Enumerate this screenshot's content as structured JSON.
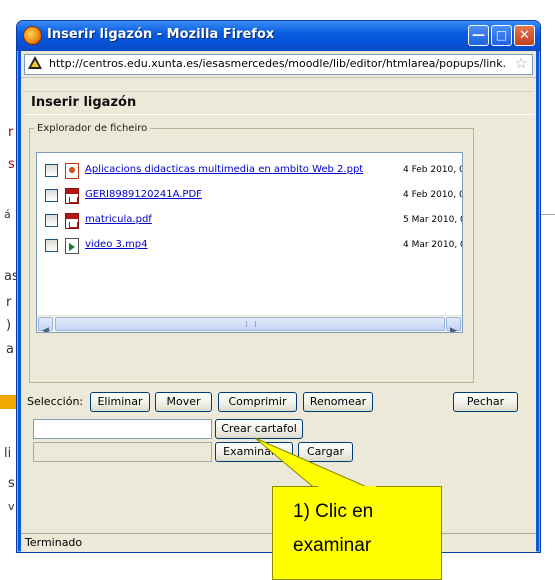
{
  "window": {
    "title": "Inserir ligazón - Mozilla Firefox",
    "url": "http://centros.edu.xunta.es/iesasmercedes/moodle/lib/editor/htmlarea/popups/link."
  },
  "dialog": {
    "heading": "Inserir ligazón",
    "explorer_legend": "Explorador de ficheiro",
    "files": [
      {
        "name": "Aplicacions didacticas multimedia en ambito Web 2.ppt",
        "date": "4 Feb 2010, 0",
        "icon": "ppt-file-icon"
      },
      {
        "name": "GERI8989120241A.PDF",
        "date": "4 Feb 2010, 0",
        "icon": "pdf-file-icon"
      },
      {
        "name": "matricula.pdf",
        "date": "5 Mar 2010, 0",
        "icon": "pdf-file-icon"
      },
      {
        "name": "video 3.mp4",
        "date": "4 Mar 2010, 0",
        "icon": "video-file-icon"
      }
    ],
    "selection_label": "Selección:",
    "buttons": {
      "delete": "Eliminar",
      "move": "Mover",
      "compress": "Comprimir",
      "rename": "Renomear",
      "close": "Pechar",
      "create_folder": "Crear cartafol",
      "browse": "Examinar...",
      "upload": "Cargar"
    }
  },
  "status": {
    "text": "Terminado"
  },
  "callout": {
    "text": "1) Clic en\nexaminar"
  },
  "background_fragments": [
    "r",
    "s",
    "á",
    "as",
    "r",
    ")",
    "a",
    "li",
    "s",
    "v"
  ],
  "colors": {
    "titlebar": "#0553d8",
    "window_body": "#ece9d8",
    "link": "#0000cc",
    "callout": "#ffff00"
  }
}
